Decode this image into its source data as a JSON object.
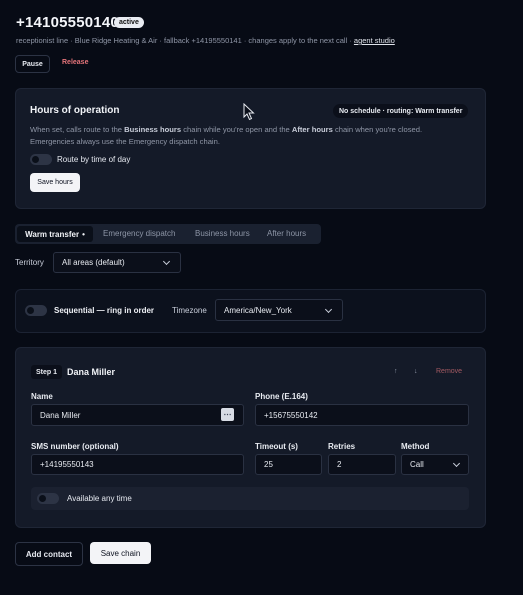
{
  "header": {
    "title": "+14105550140",
    "status_badge": "active",
    "subline": "receptionist line · Blue Ridge Heating & Air · fallback +14195550141 · changes apply to the next call ·",
    "studio_link": "agent studio",
    "pause_label": "Pause",
    "release_label": "Release"
  },
  "hours": {
    "title": "Hours of operation",
    "routing_badge": "No schedule · routing: Warm transfer",
    "desc_before_bh": "When set, calls route to the ",
    "desc_bh": "Business hours",
    "desc_mid": " chain while you're open and the ",
    "desc_ah": "After hours",
    "desc_after_ah": " chain when you're closed.",
    "desc_line2": "Emergencies always use the Emergency dispatch chain.",
    "toggle_label": "Route by time of day",
    "save_label": "Save hours"
  },
  "tabs": [
    {
      "label": "Warm transfer",
      "dot": "•"
    },
    {
      "label": "Emergency dispatch"
    },
    {
      "label": "Business hours"
    },
    {
      "label": "After hours"
    }
  ],
  "territory": {
    "label": "Territory",
    "value": "All areas (default)"
  },
  "mode": {
    "toggle_label": "Sequential — ring in order",
    "timezone_label": "Timezone",
    "timezone_value": "America/New_York"
  },
  "step": {
    "badge": "Step 1",
    "name": "Dana Miller",
    "up_label": "↑",
    "down_label": "↓",
    "remove_label": "Remove",
    "fields": {
      "name_label": "Name",
      "name_value": "Dana Miller",
      "phone_label": "Phone (E.164)",
      "phone_value": "+15675550142",
      "sms_label": "SMS number (optional)",
      "sms_value": "+14195550143",
      "timeout_label": "Timeout (s)",
      "timeout_value": "25",
      "retries_label": "Retries",
      "retries_value": "2",
      "method_label": "Method",
      "method_value": "Call"
    },
    "availability_label": "Available any time"
  },
  "footer": {
    "add_contact_label": "Add contact",
    "save_chain_label": "Save chain"
  }
}
